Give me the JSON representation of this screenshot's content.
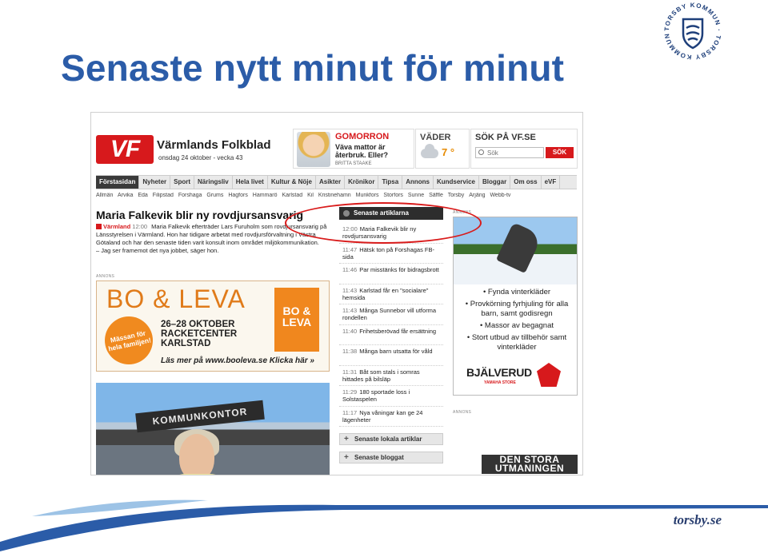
{
  "slide": {
    "title": "Senaste nytt minut för minut",
    "logo_text": "TORSBY KOMMUN · TORSBY KOMMUN ·",
    "footer_link": "torsby.se"
  },
  "site": {
    "logo_text": "VF",
    "name": "Värmlands Folkblad",
    "date": "onsdag 24 oktober - vecka 43",
    "morgon": {
      "title": "GOMORRON",
      "text": "Väva mattor är återbruk. Eller?",
      "author": "BRITTA STAAKE"
    },
    "weather": {
      "title": "VÄDER",
      "temp": "7 °"
    },
    "search": {
      "title": "SÖK PÅ VF.SE",
      "placeholder": "Sök",
      "button": "SÖK"
    },
    "nav": [
      "Förstasidan",
      "Nyheter",
      "Sport",
      "Näringsliv",
      "Hela livet",
      "Kultur & Nöje",
      "Asikter",
      "Krönikor",
      "Tipsa",
      "Annons",
      "Kundservice",
      "Bloggar",
      "Om oss",
      "eVF"
    ],
    "subnav": [
      "Allmän",
      "Arvika",
      "Eda",
      "Filipstad",
      "Forshaga",
      "Grums",
      "Hagfors",
      "Hammarö",
      "Karlstad",
      "Kil",
      "Kristinehamn",
      "Munkfors",
      "Storfors",
      "Sunne",
      "Säffle",
      "Torsby",
      "Årjäng",
      "Webb-tv"
    ],
    "headline": "Maria Falkevik blir ny rovdjursansvarig",
    "lead": {
      "tag": "Värmland",
      "time": "12:00",
      "text": "Maria Falkevik efterträder Lars Furuholm som rovdjursansvarig på Länsstyrelsen i Värmland. Hon har tidigare arbetat med rovdjursförvaltning i Västra Götaland och har den senaste tiden varit konsult inom området miljökommunikation.",
      "quote": "– Jag ser framemot det nya jobbet, säger hon."
    },
    "annons_label": "ANNONS",
    "bo_leva": {
      "title": "BO & LEVA",
      "circle": "Mässan för hela familjen!",
      "dates": "26–28 OKTOBER RACKETCENTER KARLSTAD",
      "box": "BO & LEVA",
      "link": "Läs mer på www.booleva.se Klicka här »"
    },
    "photo_sign": "KOMMUNKONTOR",
    "latest": {
      "header": "Senaste artiklarna",
      "items": [
        {
          "time": "12:00",
          "text": "Maria Falkevik blir ny rovdjursansvarig"
        },
        {
          "time": "11:47",
          "text": "Hätsk ton på Forshagas FB-sida"
        },
        {
          "time": "11:46",
          "text": "Par misstänks för bidragsbrott"
        },
        {
          "time": "11:43",
          "text": "Karlstad får en \"socialare\" hemsida"
        },
        {
          "time": "11:43",
          "text": "Många Sunnebor vill utforma rondellen"
        },
        {
          "time": "11:40",
          "text": "Frihetsberövad får ersättning"
        },
        {
          "time": "11:38",
          "text": "Många barn utsatta för våld"
        },
        {
          "time": "11:31",
          "text": "Båt som stals i somras hittades på bilsläp"
        },
        {
          "time": "11:29",
          "text": "180 sportade loss i Solstaspelen"
        },
        {
          "time": "11:17",
          "text": "Nya våningar kan ge 24 lägenheter"
        }
      ],
      "local": "Senaste lokala artiklar",
      "blogg": "Senaste bloggat"
    },
    "right_ad": {
      "items": [
        "• Fynda vinterkläder",
        "• Provkörning fyrhjuling för alla barn, samt godisregn",
        "• Massor av begagnat",
        "• Stort utbud av tillbehör samt vinterkläder"
      ],
      "brand": "BJÄLVERUD",
      "sub": "YAMAHA STORE"
    },
    "stora": "DEN STORA UTMANINGEN"
  },
  "colors": {
    "title_blue": "#2b5ca8",
    "vf_red": "#d7191c",
    "bo_orange": "#e07b1a",
    "highlight_red": "#d91b1b"
  }
}
